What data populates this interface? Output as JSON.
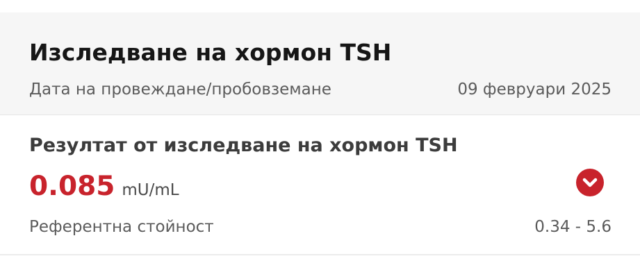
{
  "header": {
    "title": "Изследване на хормон TSH",
    "date_label": "Дата на провеждане/пробовземане",
    "date_value": "09 февруари 2025"
  },
  "result": {
    "title": "Резултат от изследване на хормон TSH",
    "value": "0.085",
    "unit": "mU/mL",
    "status_icon": "chevron-down-icon",
    "status_color": "#c8232c",
    "reference_label": "Референтна стойност",
    "reference_value": "0.34 - 5.6"
  }
}
